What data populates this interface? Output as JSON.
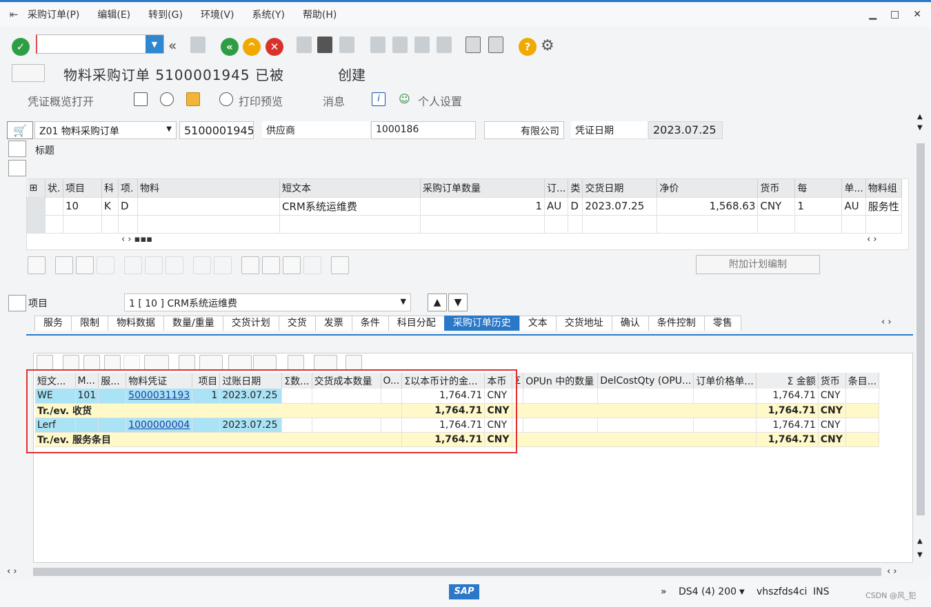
{
  "menu": [
    "采购订单(P)",
    "编辑(E)",
    "转到(G)",
    "环境(V)",
    "系统(Y)",
    "帮助(H)"
  ],
  "title": {
    "main": "物料采购订单 5100001945 已被",
    "created": "创建"
  },
  "app_toolbar": {
    "overview": "凭证概览打开",
    "print_preview": "打印预览",
    "messages": "消息",
    "personal": "个人设置"
  },
  "header": {
    "doc_type": "Z01 物料采购订单",
    "po_number": "5100001945",
    "vendor_label": "供应商",
    "vendor_code": "1000186",
    "vendor_name": "有限公司",
    "date_label": "凭证日期",
    "date_value": "2023.07.25",
    "title_label": "标题"
  },
  "overview": {
    "columns": [
      "状.",
      "项目",
      "科",
      "项.",
      "物料",
      "短文本",
      "采购订单数量",
      "订...",
      "类",
      "交货日期",
      "净价",
      "货币",
      "每",
      "单...",
      "物料组"
    ],
    "row": [
      "",
      "10",
      "K",
      "D",
      "",
      "CRM系统运维费",
      "1",
      "AU",
      "D",
      "2023.07.25",
      "1,568.63",
      "CNY",
      "1",
      "AU",
      "服务性"
    ]
  },
  "add_plan_button": "附加计划编制",
  "item_selector": {
    "label": "项目",
    "value": "1 [ 10 ] CRM系统运维费"
  },
  "tabs": [
    "服务",
    "限制",
    "物料数据",
    "数量/重量",
    "交货计划",
    "交货",
    "发票",
    "条件",
    "科目分配",
    "采购订单历史",
    "文本",
    "交货地址",
    "确认",
    "条件控制",
    "零售"
  ],
  "active_tab": "采购订单历史",
  "history": {
    "columns": [
      "短文...",
      "M...",
      "服...",
      "物料凭证",
      "项目",
      "过账日期",
      "Σ数...",
      "交货成本数量",
      "O...",
      "Σ以本币计的金...",
      "本币",
      "Σ",
      "OPUn 中的数量",
      "DelCostQty (OPU...",
      "订单价格单...",
      "Σ 金额",
      "货币",
      "条目..."
    ],
    "rows": [
      {
        "type": "data",
        "cells": [
          "WE",
          "101",
          "",
          "5000031193",
          "1",
          "2023.07.25",
          "",
          "",
          "",
          "1,764.71",
          "CNY",
          "",
          "",
          "",
          "",
          "1,764.71",
          "CNY",
          ""
        ]
      },
      {
        "type": "sub",
        "label": "Tr./ev. 收货",
        "amount": "1,764.71",
        "cur": "CNY",
        "amount2": "1,764.71",
        "cur2": "CNY"
      },
      {
        "type": "data",
        "cells": [
          "Lerf",
          "",
          "",
          "1000000004",
          "",
          "2023.07.25",
          "",
          "",
          "",
          "1,764.71",
          "CNY",
          "",
          "",
          "",
          "",
          "1,764.71",
          "CNY",
          ""
        ]
      },
      {
        "type": "sub",
        "label": "Tr./ev. 服务条目",
        "amount": "1,764.71",
        "cur": "CNY",
        "amount2": "1,764.71",
        "cur2": "CNY"
      }
    ]
  },
  "status": {
    "system": "DS4 (4) 200",
    "host": "vhszfds4ci",
    "mode": "INS",
    "watermark": "CSDN @风_犯"
  }
}
